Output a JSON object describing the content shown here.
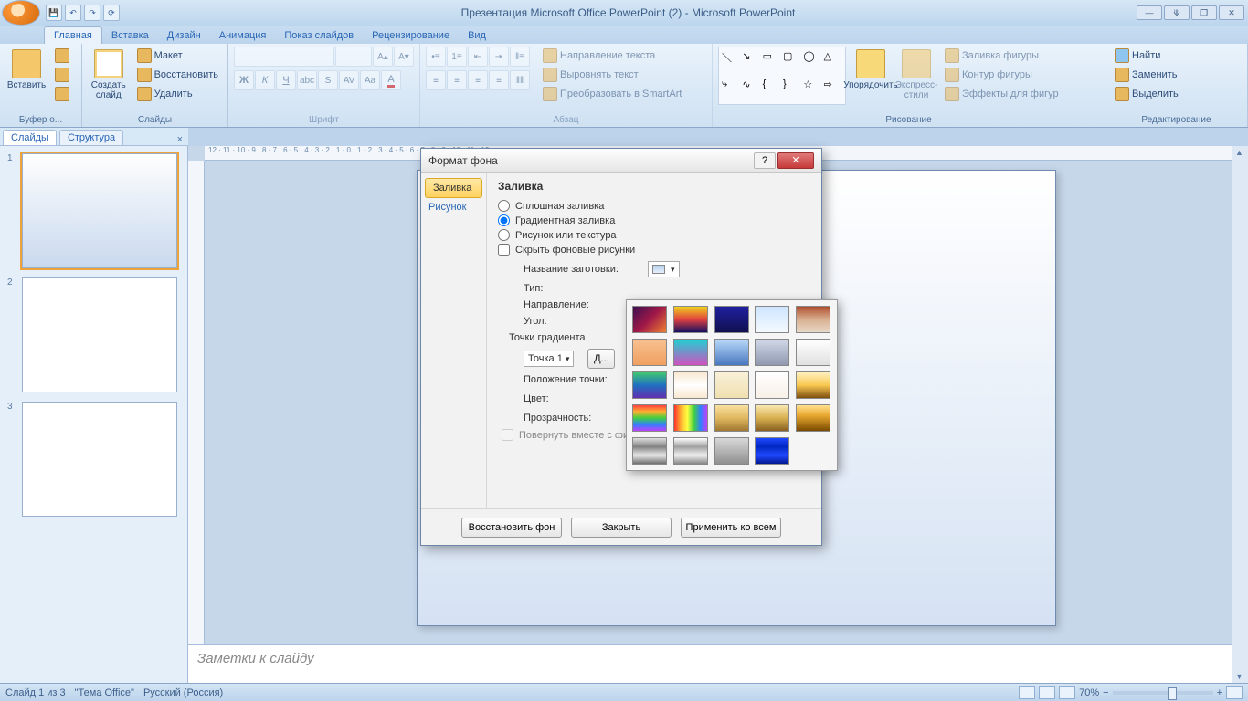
{
  "title": "Презентация Microsoft Office PowerPoint (2) - Microsoft PowerPoint",
  "window_controls": {
    "min": "—",
    "max": "❐",
    "restore": "⟱",
    "close": "✕"
  },
  "qat": [
    "💾",
    "↶",
    "↷",
    "⟳"
  ],
  "tabs": [
    "Главная",
    "Вставка",
    "Дизайн",
    "Анимация",
    "Показ слайдов",
    "Рецензирование",
    "Вид"
  ],
  "ribbon": {
    "clipboard": {
      "paste": "Вставить",
      "label": "Буфер о..."
    },
    "slides": {
      "new": "Создать\nслайд",
      "layout": "Макет",
      "reset": "Восстановить",
      "delete": "Удалить",
      "label": "Слайды"
    },
    "font_label": "Шрифт",
    "paragraph": {
      "label": "Абзац",
      "textdir": "Направление текста",
      "align": "Выровнять текст",
      "smartart": "Преобразовать в SmartArt"
    },
    "drawing": {
      "arrange": "Упорядочить",
      "quick": "Экспресс-стили",
      "fill": "Заливка фигуры",
      "outline": "Контур фигуры",
      "effects": "Эффекты для фигур",
      "label": "Рисование"
    },
    "editing": {
      "find": "Найти",
      "replace": "Заменить",
      "select": "Выделить",
      "label": "Редактирование"
    }
  },
  "panel_tabs": {
    "slides": "Слайды",
    "outline": "Структура"
  },
  "thumbs": [
    "1",
    "2",
    "3"
  ],
  "ruler_text": "12 · 11 · 10 · 9 · 8 · 7 · 6 · 5 · 4 · 3 · 2 · 1 · 0 · 1 · 2 · 3 · 4 · 5 · 6 · 7 · 8 · 9 · 10 · 11 · 12",
  "notes_placeholder": "Заметки к слайду",
  "status": {
    "slide": "Слайд 1 из 3",
    "theme": "\"Тема Office\"",
    "lang": "Русский (Россия)",
    "zoom": "70%"
  },
  "dialog": {
    "title": "Формат фона",
    "tabs": {
      "fill": "Заливка",
      "picture": "Рисунок"
    },
    "heading": "Заливка",
    "opts": {
      "solid": "Сплошная заливка",
      "gradient": "Градиентная заливка",
      "pic": "Рисунок или текстура",
      "hide": "Скрыть фоновые рисунки"
    },
    "preset": "Название заготовки:",
    "type": "Тип:",
    "dir": "Направление:",
    "angle": "Угол:",
    "stops": "Точки градиента",
    "stop1": "Точка 1",
    "addstop": "Д...",
    "stoppos": "Положение точки:",
    "color": "Цвет:",
    "trans": "Прозрачность:",
    "rotate": "Повернуть вместе с фигурой",
    "reset": "Восстановить фон",
    "close": "Закрыть",
    "apply": "Применить ко всем"
  },
  "gradients": [
    "linear-gradient(135deg,#3d1050,#a01848,#f08030)",
    "linear-gradient(#f0d020,#e04040,#101060)",
    "linear-gradient(#2020a0,#101050)",
    "linear-gradient(#cee5ff,#f4f9ff)",
    "linear-gradient(#b05030,#d8b090,#e8d8c8)",
    "linear-gradient(#f8c090,#f0a060)",
    "linear-gradient(#20d0d0,#d050c0)",
    "linear-gradient(#b8d8f8,#4878c0)",
    "linear-gradient(#d0d8e8,#9098b0)",
    "linear-gradient(#ffffff,#e0e0e0)",
    "linear-gradient(#40c870,#2070c0,#6030b0)",
    "linear-gradient(#f8e8d0,#ffffff,#f8e8d0)",
    "linear-gradient(#f8f0d8,#f0e0b0)",
    "linear-gradient(#ffffff,#f8f0e8)",
    "linear-gradient(#fff0c0,#f8c850,#805010)",
    "linear-gradient(#ff4040,#ffb030,#40d040,#3080ff,#c040ff)",
    "linear-gradient(90deg,#ff3030,#ffb030,#ffff40,#40d040,#3080ff,#c040ff)",
    "linear-gradient(#f8e0a0,#e0b860,#a07830)",
    "linear-gradient(#f8e8b0,#d8b050,#886020)",
    "linear-gradient(#ffe090,#e8a830 40%,#7a4a00)",
    "linear-gradient(#e0e0e0,#808080,#e8e8e8,#707070)",
    "linear-gradient(#ffffff,#a0a0a0,#f0f0f0,#888888)",
    "linear-gradient(#d8d8d8,#909090)",
    "linear-gradient(#2048ff,#0028c0,#2048ff,#001890)"
  ]
}
